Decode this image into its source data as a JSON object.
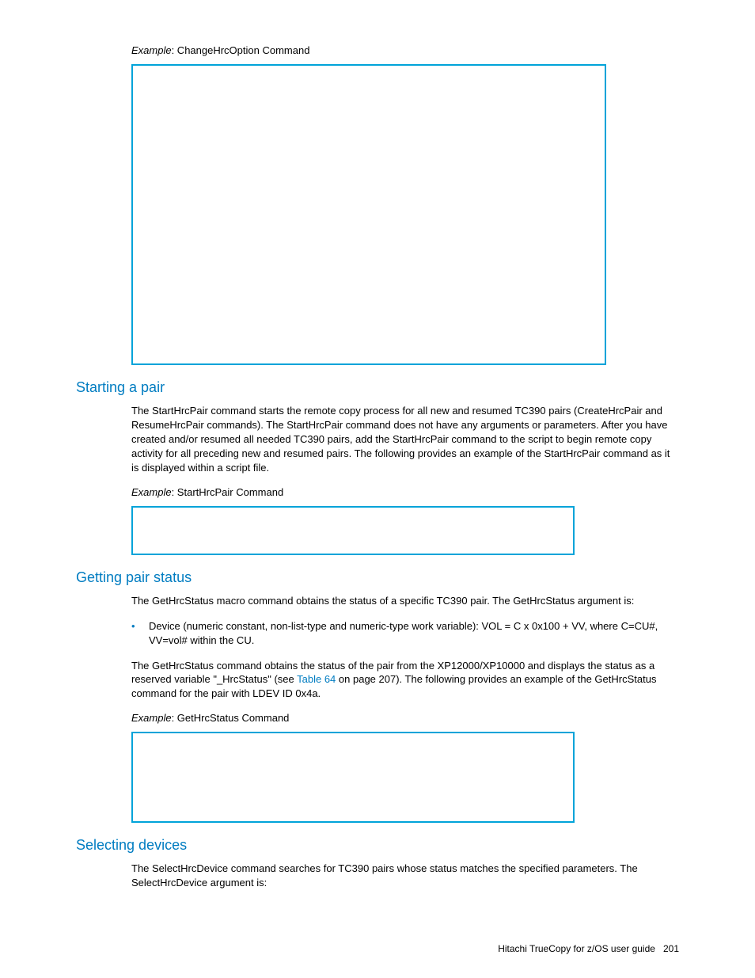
{
  "example1": {
    "prefix": "Example",
    "label": ": ChangeHrcOption Command"
  },
  "section1": {
    "heading": "Starting a pair",
    "paragraph": "The StartHrcPair command starts the remote copy process for all new and resumed TC390 pairs (CreateHrcPair and ResumeHrcPair commands). The StartHrcPair command does not have any arguments or parameters. After you have created and/or resumed all needed TC390 pairs, add the StartHrcPair command to the script to begin remote copy activity for all preceding new and resumed pairs. The following provides an example of the StartHrcPair command as it is displayed within a script file.",
    "example_prefix": "Example",
    "example_label": ": StartHrcPair Command"
  },
  "section2": {
    "heading": "Getting pair status",
    "paragraph1": "The GetHrcStatus macro command obtains the status of a specific TC390 pair. The GetHrcStatus argument is:",
    "bullet": "Device (numeric constant, non-list-type and numeric-type work variable): VOL = C x 0x100 + VV, where C=CU#, VV=vol# within the CU.",
    "paragraph2a": "The GetHrcStatus command obtains the status of the pair from the XP12000/XP10000 and displays the status as a reserved variable \"_HrcStatus\" (see ",
    "link": "Table 64",
    "paragraph2b": " on page 207). The following provides an example of the GetHrcStatus command for the pair with LDEV ID 0x4a.",
    "example_prefix": "Example",
    "example_label": ": GetHrcStatus Command"
  },
  "section3": {
    "heading": "Selecting devices",
    "paragraph": "The SelectHrcDevice command searches for TC390 pairs whose status matches the specified parameters. The SelectHrcDevice argument is:"
  },
  "footer": {
    "title": "Hitachi TrueCopy for z/OS user guide",
    "page": "201"
  }
}
